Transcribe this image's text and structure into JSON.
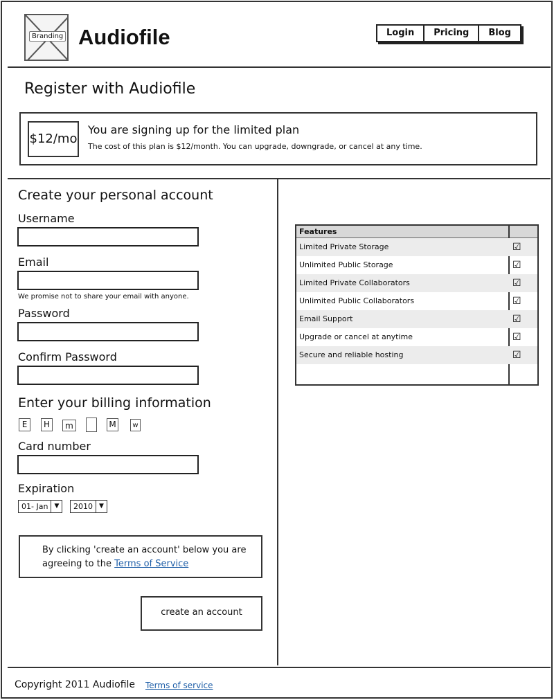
{
  "header": {
    "logo_label": "Branding",
    "app_title": "Audiofile",
    "nav": [
      "Login",
      "Pricing",
      "Blog"
    ]
  },
  "register_title": "Register with Audiofile",
  "plan": {
    "price": "$12/mo",
    "heading": "You are signing up for the limited plan",
    "description": "The cost of this plan is $12/month. You can upgrade, downgrade, or cancel at any time."
  },
  "account": {
    "title": "Create your personal account",
    "username_label": "Username",
    "email_label": "Email",
    "email_note": "We promise not to share your email with anyone.",
    "password_label": "Password",
    "confirm_password_label": "Confirm Password"
  },
  "billing": {
    "title": "Enter your billing information",
    "card_icons": [
      "E",
      "H",
      "m",
      "",
      "M",
      "w"
    ],
    "card_number_label": "Card number",
    "expiration_label": "Expiration",
    "month_value": "01- Jan",
    "year_value": "2010"
  },
  "tos": {
    "text": "By clicking 'create an account' below you are agreeing to the ",
    "link": "Terms of Service"
  },
  "create_button": "create an account",
  "features": {
    "header": "Features",
    "items": [
      {
        "label": "Limited Private Storage",
        "checked": true
      },
      {
        "label": "Unlimited Public Storage",
        "checked": true
      },
      {
        "label": "Limited Private Collaborators",
        "checked": true
      },
      {
        "label": "Unlimited Public Collaborators",
        "checked": true
      },
      {
        "label": "Email Support",
        "checked": true
      },
      {
        "label": "Upgrade or cancel at anytime",
        "checked": true
      },
      {
        "label": "Secure and reliable hosting",
        "checked": true
      }
    ]
  },
  "footer": {
    "copyright": "Copyright 2011 Audiofile",
    "link": "Terms of service"
  }
}
